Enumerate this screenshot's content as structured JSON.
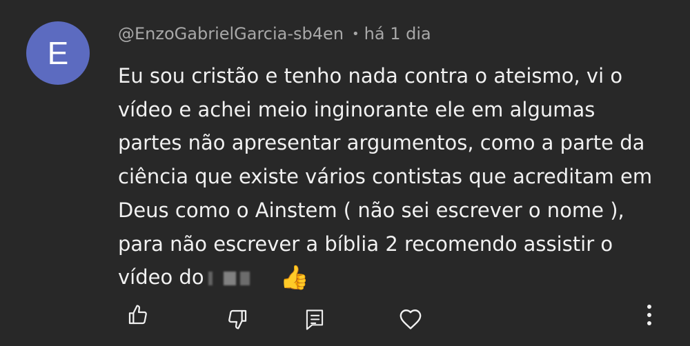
{
  "comment": {
    "author_initial": "E",
    "author_handle": "@EnzoGabrielGarcia-sb4en",
    "separator": "•",
    "timestamp": "há 1 dia",
    "text_lines": [
      "Eu sou cristão e tenho nada contra o ateismo, vi o",
      "vídeo e achei meio inginorante ele em algumas",
      "partes não apresentar argumentos, como a parte da",
      "ciência que existe vários contistas que acreditam em",
      "Deus como o Ainstem ( não sei escrever o nome ),",
      "para não escrever a bíblia 2 recomendo assistir o",
      "vídeo do"
    ],
    "emoji": "👍"
  },
  "actions": {
    "icons": [
      "thumbs-up-icon",
      "thumbs-down-icon",
      "reply-icon",
      "heart-icon",
      "more-vertical-icon"
    ]
  },
  "colors": {
    "background": "#282828",
    "avatar": "#5c6bc0",
    "text": "#f1f1f1",
    "muted_text": "#a8a8a8"
  }
}
